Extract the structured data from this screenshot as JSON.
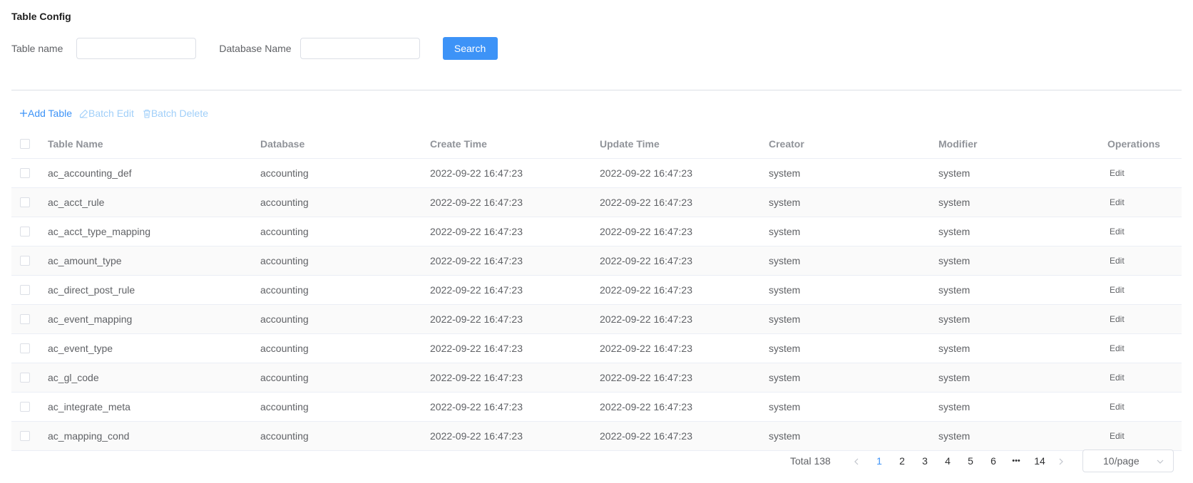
{
  "page": {
    "title": "Table Config"
  },
  "filters": {
    "table_name_label": "Table name",
    "table_name_value": "",
    "database_name_label": "Database Name",
    "database_name_value": "",
    "search_label": "Search"
  },
  "toolbar": {
    "add_label": "Add Table",
    "batch_edit_label": "Batch Edit",
    "batch_delete_label": "Batch Delete",
    "primary_color": "#3d93f7",
    "disabled_color": "#a0cff9"
  },
  "table": {
    "columns": [
      "Table Name",
      "Database",
      "Create Time",
      "Update Time",
      "Creator",
      "Modifier",
      "Operations"
    ],
    "rows": [
      {
        "name": "ac_accounting_def",
        "database": "accounting",
        "create_time": "2022-09-22 16:47:23",
        "update_time": "2022-09-22 16:47:23",
        "creator": "system",
        "modifier": "system",
        "op": "Edit"
      },
      {
        "name": "ac_acct_rule",
        "database": "accounting",
        "create_time": "2022-09-22 16:47:23",
        "update_time": "2022-09-22 16:47:23",
        "creator": "system",
        "modifier": "system",
        "op": "Edit"
      },
      {
        "name": "ac_acct_type_mapping",
        "database": "accounting",
        "create_time": "2022-09-22 16:47:23",
        "update_time": "2022-09-22 16:47:23",
        "creator": "system",
        "modifier": "system",
        "op": "Edit"
      },
      {
        "name": "ac_amount_type",
        "database": "accounting",
        "create_time": "2022-09-22 16:47:23",
        "update_time": "2022-09-22 16:47:23",
        "creator": "system",
        "modifier": "system",
        "op": "Edit"
      },
      {
        "name": "ac_direct_post_rule",
        "database": "accounting",
        "create_time": "2022-09-22 16:47:23",
        "update_time": "2022-09-22 16:47:23",
        "creator": "system",
        "modifier": "system",
        "op": "Edit"
      },
      {
        "name": "ac_event_mapping",
        "database": "accounting",
        "create_time": "2022-09-22 16:47:23",
        "update_time": "2022-09-22 16:47:23",
        "creator": "system",
        "modifier": "system",
        "op": "Edit"
      },
      {
        "name": "ac_event_type",
        "database": "accounting",
        "create_time": "2022-09-22 16:47:23",
        "update_time": "2022-09-22 16:47:23",
        "creator": "system",
        "modifier": "system",
        "op": "Edit"
      },
      {
        "name": "ac_gl_code",
        "database": "accounting",
        "create_time": "2022-09-22 16:47:23",
        "update_time": "2022-09-22 16:47:23",
        "creator": "system",
        "modifier": "system",
        "op": "Edit"
      },
      {
        "name": "ac_integrate_meta",
        "database": "accounting",
        "create_time": "2022-09-22 16:47:23",
        "update_time": "2022-09-22 16:47:23",
        "creator": "system",
        "modifier": "system",
        "op": "Edit"
      },
      {
        "name": "ac_mapping_cond",
        "database": "accounting",
        "create_time": "2022-09-22 16:47:23",
        "update_time": "2022-09-22 16:47:23",
        "creator": "system",
        "modifier": "system",
        "op": "Edit"
      }
    ]
  },
  "pagination": {
    "total_label": "Total 138",
    "pages": [
      "1",
      "2",
      "3",
      "4",
      "5",
      "6",
      "•••",
      "14"
    ],
    "current": "1",
    "page_size": "10/page"
  },
  "icons": {
    "add": "plus-icon",
    "batch_edit": "pencil-icon",
    "batch_delete": "trash-icon",
    "prev": "chevron-left-icon",
    "next": "chevron-right-icon",
    "select": "chevron-down-icon"
  }
}
